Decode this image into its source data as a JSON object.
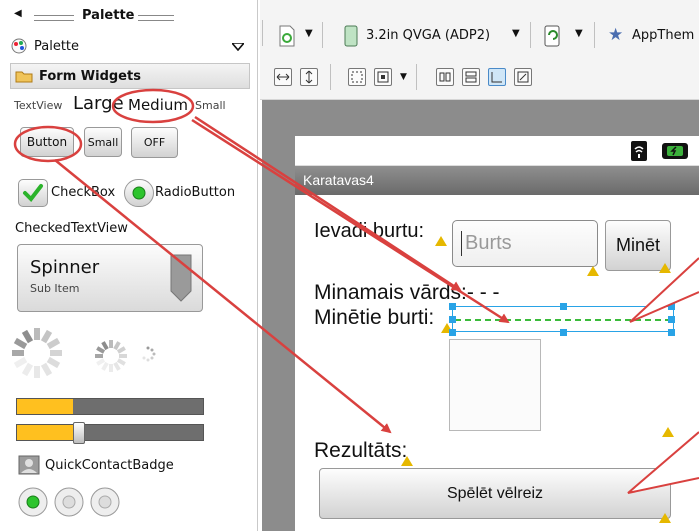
{
  "palette": {
    "title": "Palette",
    "dropdown_label": "Palette",
    "group_label": "Form Widgets",
    "textview": {
      "label": "TextView",
      "large": "Large",
      "medium": "Medium",
      "small": "Small"
    },
    "buttons": {
      "button": "Button",
      "small": "Small",
      "toggle": "OFF"
    },
    "checkbox": "CheckBox",
    "radiobutton": "RadioButton",
    "checkedtextview": "CheckedTextView",
    "spinner": {
      "title": "Spinner",
      "subtitle": "Sub Item"
    },
    "progress": [
      {
        "level": 0.3
      },
      {
        "level": 0.31
      }
    ],
    "quickcontact": "QuickContactBadge"
  },
  "toolbar": {
    "device": "3.2in QVGA (ADP2)",
    "theme": "AppThem"
  },
  "app": {
    "title": "Karatavas4",
    "input_label": "Ievadi burtu:",
    "input_placeholder": "Burts",
    "guess_button": "Minēt",
    "word_label": "Minamais vārds:- - -",
    "guessed_label": "Minētie burti:",
    "result_label": "Rezultāts:",
    "replay_button": "Spēlēt vēlreiz"
  },
  "colors": {
    "accent": "#d9413f",
    "progress": "#ffc01f",
    "selection": "#29a3e6"
  }
}
